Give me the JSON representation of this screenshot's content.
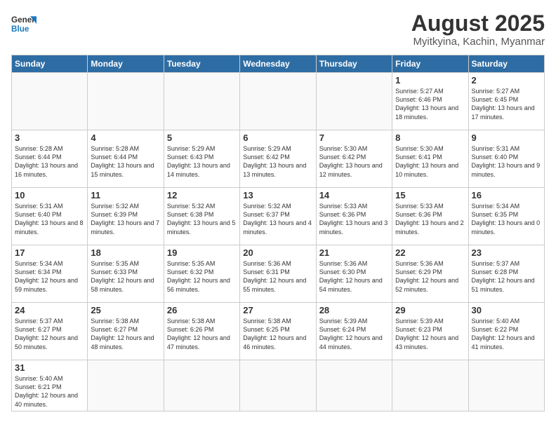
{
  "logo": {
    "line1": "General",
    "line2": "Blue"
  },
  "title": "August 2025",
  "subtitle": "Myitkyina, Kachin, Myanmar",
  "weekdays": [
    "Sunday",
    "Monday",
    "Tuesday",
    "Wednesday",
    "Thursday",
    "Friday",
    "Saturday"
  ],
  "weeks": [
    [
      {
        "day": "",
        "info": ""
      },
      {
        "day": "",
        "info": ""
      },
      {
        "day": "",
        "info": ""
      },
      {
        "day": "",
        "info": ""
      },
      {
        "day": "",
        "info": ""
      },
      {
        "day": "1",
        "info": "Sunrise: 5:27 AM\nSunset: 6:46 PM\nDaylight: 13 hours and 18 minutes."
      },
      {
        "day": "2",
        "info": "Sunrise: 5:27 AM\nSunset: 6:45 PM\nDaylight: 13 hours and 17 minutes."
      }
    ],
    [
      {
        "day": "3",
        "info": "Sunrise: 5:28 AM\nSunset: 6:44 PM\nDaylight: 13 hours and 16 minutes."
      },
      {
        "day": "4",
        "info": "Sunrise: 5:28 AM\nSunset: 6:44 PM\nDaylight: 13 hours and 15 minutes."
      },
      {
        "day": "5",
        "info": "Sunrise: 5:29 AM\nSunset: 6:43 PM\nDaylight: 13 hours and 14 minutes."
      },
      {
        "day": "6",
        "info": "Sunrise: 5:29 AM\nSunset: 6:42 PM\nDaylight: 13 hours and 13 minutes."
      },
      {
        "day": "7",
        "info": "Sunrise: 5:30 AM\nSunset: 6:42 PM\nDaylight: 13 hours and 12 minutes."
      },
      {
        "day": "8",
        "info": "Sunrise: 5:30 AM\nSunset: 6:41 PM\nDaylight: 13 hours and 10 minutes."
      },
      {
        "day": "9",
        "info": "Sunrise: 5:31 AM\nSunset: 6:40 PM\nDaylight: 13 hours and 9 minutes."
      }
    ],
    [
      {
        "day": "10",
        "info": "Sunrise: 5:31 AM\nSunset: 6:40 PM\nDaylight: 13 hours and 8 minutes."
      },
      {
        "day": "11",
        "info": "Sunrise: 5:32 AM\nSunset: 6:39 PM\nDaylight: 13 hours and 7 minutes."
      },
      {
        "day": "12",
        "info": "Sunrise: 5:32 AM\nSunset: 6:38 PM\nDaylight: 13 hours and 5 minutes."
      },
      {
        "day": "13",
        "info": "Sunrise: 5:32 AM\nSunset: 6:37 PM\nDaylight: 13 hours and 4 minutes."
      },
      {
        "day": "14",
        "info": "Sunrise: 5:33 AM\nSunset: 6:36 PM\nDaylight: 13 hours and 3 minutes."
      },
      {
        "day": "15",
        "info": "Sunrise: 5:33 AM\nSunset: 6:36 PM\nDaylight: 13 hours and 2 minutes."
      },
      {
        "day": "16",
        "info": "Sunrise: 5:34 AM\nSunset: 6:35 PM\nDaylight: 13 hours and 0 minutes."
      }
    ],
    [
      {
        "day": "17",
        "info": "Sunrise: 5:34 AM\nSunset: 6:34 PM\nDaylight: 12 hours and 59 minutes."
      },
      {
        "day": "18",
        "info": "Sunrise: 5:35 AM\nSunset: 6:33 PM\nDaylight: 12 hours and 58 minutes."
      },
      {
        "day": "19",
        "info": "Sunrise: 5:35 AM\nSunset: 6:32 PM\nDaylight: 12 hours and 56 minutes."
      },
      {
        "day": "20",
        "info": "Sunrise: 5:36 AM\nSunset: 6:31 PM\nDaylight: 12 hours and 55 minutes."
      },
      {
        "day": "21",
        "info": "Sunrise: 5:36 AM\nSunset: 6:30 PM\nDaylight: 12 hours and 54 minutes."
      },
      {
        "day": "22",
        "info": "Sunrise: 5:36 AM\nSunset: 6:29 PM\nDaylight: 12 hours and 52 minutes."
      },
      {
        "day": "23",
        "info": "Sunrise: 5:37 AM\nSunset: 6:28 PM\nDaylight: 12 hours and 51 minutes."
      }
    ],
    [
      {
        "day": "24",
        "info": "Sunrise: 5:37 AM\nSunset: 6:27 PM\nDaylight: 12 hours and 50 minutes."
      },
      {
        "day": "25",
        "info": "Sunrise: 5:38 AM\nSunset: 6:27 PM\nDaylight: 12 hours and 48 minutes."
      },
      {
        "day": "26",
        "info": "Sunrise: 5:38 AM\nSunset: 6:26 PM\nDaylight: 12 hours and 47 minutes."
      },
      {
        "day": "27",
        "info": "Sunrise: 5:38 AM\nSunset: 6:25 PM\nDaylight: 12 hours and 46 minutes."
      },
      {
        "day": "28",
        "info": "Sunrise: 5:39 AM\nSunset: 6:24 PM\nDaylight: 12 hours and 44 minutes."
      },
      {
        "day": "29",
        "info": "Sunrise: 5:39 AM\nSunset: 6:23 PM\nDaylight: 12 hours and 43 minutes."
      },
      {
        "day": "30",
        "info": "Sunrise: 5:40 AM\nSunset: 6:22 PM\nDaylight: 12 hours and 41 minutes."
      }
    ],
    [
      {
        "day": "31",
        "info": "Sunrise: 5:40 AM\nSunset: 6:21 PM\nDaylight: 12 hours and 40 minutes."
      },
      {
        "day": "",
        "info": ""
      },
      {
        "day": "",
        "info": ""
      },
      {
        "day": "",
        "info": ""
      },
      {
        "day": "",
        "info": ""
      },
      {
        "day": "",
        "info": ""
      },
      {
        "day": "",
        "info": ""
      }
    ]
  ]
}
